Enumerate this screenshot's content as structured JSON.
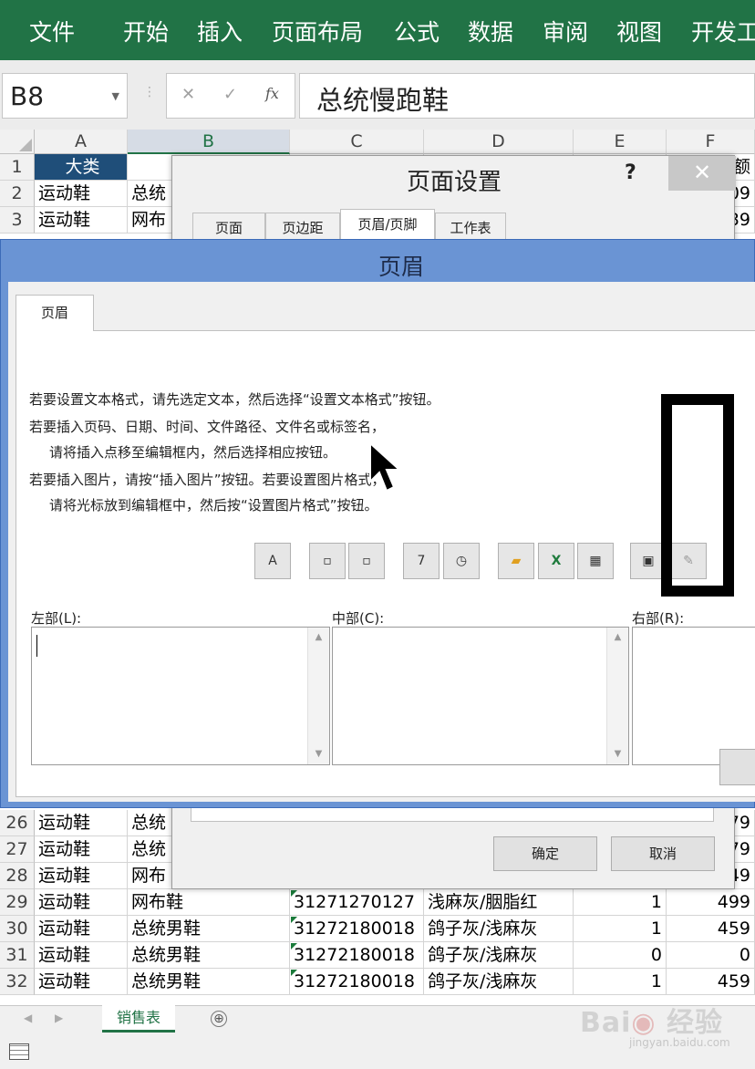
{
  "ribbon": {
    "tabs": [
      "文件",
      "开始",
      "插入",
      "页面布局",
      "公式",
      "数据",
      "审阅",
      "视图",
      "开发工"
    ],
    "color": "#217346"
  },
  "formula_bar": {
    "name_box": "B8",
    "cancel_icon": "✕",
    "enter_icon": "✓",
    "fx_label": "fx",
    "content": "总统慢跑鞋"
  },
  "sheet": {
    "columns": [
      "A",
      "B",
      "C",
      "D",
      "E",
      "F"
    ],
    "selected_column": "B",
    "top_rows": [
      {
        "num": "1",
        "cells": [
          "大类",
          "",
          "",
          "",
          "",
          "额"
        ]
      },
      {
        "num": "2",
        "cells": [
          "运动鞋",
          "总统",
          "",
          "",
          "",
          "09"
        ]
      },
      {
        "num": "3",
        "cells": [
          "运动鞋",
          "网布",
          "",
          "",
          "",
          "39"
        ]
      }
    ],
    "bottom_rows": [
      {
        "num": "26",
        "cells": [
          "运动鞋",
          "总统",
          "",
          "",
          "",
          "79"
        ]
      },
      {
        "num": "27",
        "cells": [
          "运动鞋",
          "总统",
          "",
          "",
          "",
          "79"
        ]
      },
      {
        "num": "28",
        "cells": [
          "运动鞋",
          "网布",
          "",
          "",
          "",
          "49"
        ]
      },
      {
        "num": "29",
        "cells": [
          "运动鞋",
          "网布鞋",
          "31271270127",
          "浅麻灰/胭脂红",
          "1",
          "499"
        ]
      },
      {
        "num": "30",
        "cells": [
          "运动鞋",
          "总统男鞋",
          "31272180018",
          "鸽子灰/浅麻灰",
          "1",
          "459"
        ]
      },
      {
        "num": "31",
        "cells": [
          "运动鞋",
          "总统男鞋",
          "31272180018",
          "鸽子灰/浅麻灰",
          "0",
          "0"
        ]
      },
      {
        "num": "32",
        "cells": [
          "运动鞋",
          "总统男鞋",
          "31272180018",
          "鸽子灰/浅麻灰",
          "1",
          "459"
        ]
      }
    ],
    "active_tab": "销售表",
    "add_sheet": "⊕"
  },
  "page_setup_dialog": {
    "title": "页面设置",
    "help": "?",
    "close": "✕",
    "tabs": [
      "页面",
      "页边距",
      "页眉/页脚",
      "工作表"
    ],
    "active_tab": "页眉/页脚",
    "ok": "确定",
    "cancel": "取消"
  },
  "header_dialog": {
    "title": "页眉",
    "tab": "页眉",
    "instructions": [
      "若要设置文本格式，请先选定文本，然后选择“设置文本格式”按钮。",
      "若要插入页码、日期、时间、文件路径、文件名或标签名，",
      "请将插入点移至编辑框内，然后选择相应按钮。",
      "若要插入图片，请按“插入图片”按钮。若要设置图片格式，",
      "请将光标放到编辑框中，然后按“设置图片格式”按钮。"
    ],
    "toolbar": [
      {
        "name": "format-text",
        "glyph": "A"
      },
      {
        "name": "insert-page-number",
        "glyph": "▫"
      },
      {
        "name": "insert-page-count",
        "glyph": "▫"
      },
      {
        "name": "insert-date",
        "glyph": "7"
      },
      {
        "name": "insert-time",
        "glyph": "◷"
      },
      {
        "name": "insert-file-path",
        "glyph": "▰"
      },
      {
        "name": "insert-file-name",
        "glyph": "X"
      },
      {
        "name": "insert-sheet-name",
        "glyph": "▦"
      },
      {
        "name": "insert-picture",
        "glyph": "▣"
      },
      {
        "name": "format-picture",
        "glyph": "✎"
      }
    ],
    "sections": {
      "left": "左部(L):",
      "center": "中部(C):",
      "right": "右部(R):"
    }
  },
  "watermark": {
    "text": "Bai 经验",
    "url": "jingyan.baidu.com"
  }
}
